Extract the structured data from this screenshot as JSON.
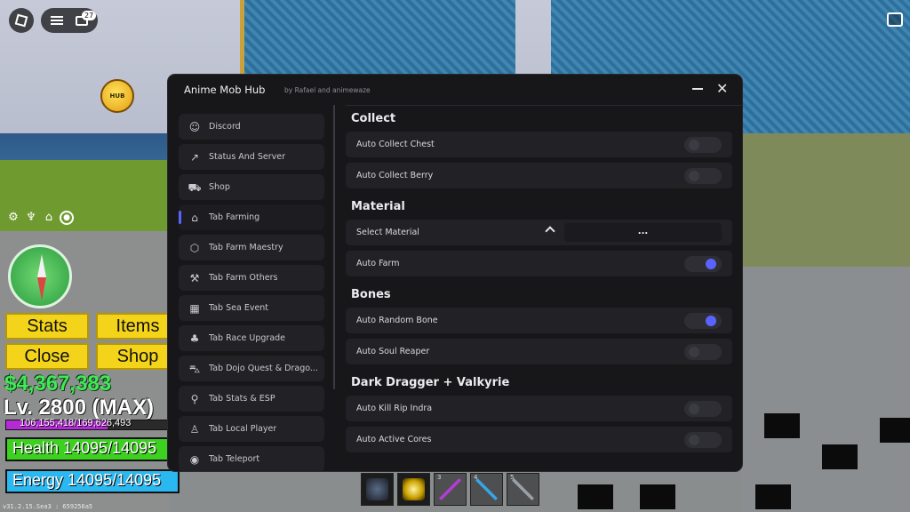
{
  "roblox": {
    "notification_count": "27"
  },
  "mascot": {
    "label": "HUB"
  },
  "hud": {
    "buttons": {
      "stats": "Stats",
      "items": "Items",
      "close": "Close",
      "shop": "Shop"
    },
    "money": "$4,367,383",
    "level": "Lv. 2800 (MAX)",
    "xp": {
      "text": "106,155,418/169,626,493",
      "fraction": 0.626
    },
    "health": {
      "text": "Health 14095/14095",
      "fraction": 1.0
    },
    "energy": {
      "text": "Energy 14095/14095",
      "fraction": 1.0
    },
    "version": "v31.2.15.Sea3 : 659256a5"
  },
  "hotbar": [
    {
      "num": "",
      "icon": "dragon-icon"
    },
    {
      "num": "",
      "icon": "lightning-icon"
    },
    {
      "num": "3",
      "icon": "sword-icon"
    },
    {
      "num": "4",
      "icon": "sword-icon"
    },
    {
      "num": "5",
      "icon": "sword-icon"
    }
  ],
  "hub": {
    "title": "Anime Mob Hub",
    "subtitle": "by Rafael and animewaze",
    "sidebar": [
      {
        "label": "Discord",
        "icon": "discord-icon",
        "active": false
      },
      {
        "label": "Status And Server",
        "icon": "chart-icon",
        "active": false
      },
      {
        "label": "Shop",
        "icon": "cart-icon",
        "active": false
      },
      {
        "label": "Tab Farming",
        "icon": "home-icon",
        "active": true
      },
      {
        "label": "Tab Farm Maestry",
        "icon": "cube-icon",
        "active": false
      },
      {
        "label": "Tab Farm Others",
        "icon": "tool-icon",
        "active": false
      },
      {
        "label": "Tab Sea Event",
        "icon": "calendar-icon",
        "active": false
      },
      {
        "label": "Tab Race Upgrade",
        "icon": "plant-icon",
        "active": false
      },
      {
        "label": "Tab Dojo Quest & Drago...",
        "icon": "car-icon",
        "active": false
      },
      {
        "label": "Tab Stats & ESP",
        "icon": "map-pin-icon",
        "active": false
      },
      {
        "label": "Tab Local Player",
        "icon": "person-icon",
        "active": false
      },
      {
        "label": "Tab Teleport",
        "icon": "location-icon",
        "active": false
      }
    ],
    "sections": {
      "collect": {
        "title": "Collect",
        "rows": [
          {
            "label": "Auto Collect Chest",
            "on": false
          },
          {
            "label": "Auto Collect Berry",
            "on": false
          }
        ]
      },
      "material": {
        "title": "Material",
        "select_label": "Select Material",
        "select_value": "...",
        "rows": [
          {
            "label": "Auto Farm",
            "on": true
          }
        ]
      },
      "bones": {
        "title": "Bones",
        "rows": [
          {
            "label": "Auto Random Bone",
            "on": true
          },
          {
            "label": "Auto Soul Reaper",
            "on": false
          }
        ]
      },
      "dark": {
        "title": "Dark Dragger + Valkyrie",
        "rows": [
          {
            "label": "Auto Kill Rip Indra",
            "on": false
          },
          {
            "label": "Auto Active Cores",
            "on": false
          }
        ]
      }
    }
  }
}
